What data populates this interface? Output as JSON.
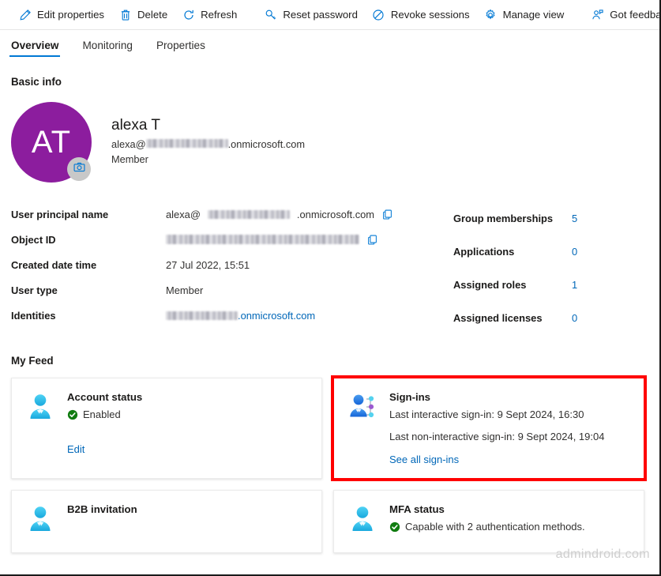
{
  "toolbar": {
    "items": [
      {
        "label": "Edit properties",
        "icon": "pencil-icon"
      },
      {
        "label": "Delete",
        "icon": "trash-icon"
      },
      {
        "label": "Refresh",
        "icon": "refresh-icon"
      },
      {
        "label": "Reset password",
        "icon": "key-icon"
      },
      {
        "label": "Revoke sessions",
        "icon": "block-icon"
      },
      {
        "label": "Manage view",
        "icon": "gear-icon"
      },
      {
        "label": "Got feedback?",
        "icon": "feedback-person-icon"
      }
    ]
  },
  "tabs": [
    {
      "label": "Overview",
      "active": true
    },
    {
      "label": "Monitoring",
      "active": false
    },
    {
      "label": "Properties",
      "active": false
    }
  ],
  "sections": {
    "basic_info": "Basic info",
    "my_feed": "My Feed"
  },
  "identity": {
    "initials": "AT",
    "display_name": "alexa T",
    "upn_prefix": "alexa@",
    "upn_suffix": ".onmicrosoft.com",
    "user_type": "Member",
    "camera_icon": "camera-icon"
  },
  "properties_left": [
    {
      "label": "User principal name",
      "value_prefix": "alexa@",
      "value_suffix": ".onmicrosoft.com",
      "redacted": true,
      "redact_width": 104,
      "copy": true
    },
    {
      "label": "Object ID",
      "value_prefix": "",
      "value_suffix": "",
      "redacted": true,
      "redact_width": 245,
      "copy": true
    },
    {
      "label": "Created date time",
      "value_prefix": "27 Jul 2022, 15:51",
      "value_suffix": "",
      "redacted": false,
      "copy": false
    },
    {
      "label": "User type",
      "value_prefix": "Member",
      "value_suffix": "",
      "redacted": false,
      "copy": false
    },
    {
      "label": "Identities",
      "value_prefix": "",
      "value_suffix": ".onmicrosoft.com",
      "redacted": true,
      "redact_width": 91,
      "copy": false,
      "link": true
    }
  ],
  "properties_right": [
    {
      "label": "Group memberships",
      "value": "5"
    },
    {
      "label": "Applications",
      "value": "0"
    },
    {
      "label": "Assigned roles",
      "value": "1"
    },
    {
      "label": "Assigned licenses",
      "value": "0"
    }
  ],
  "feed_cards": [
    {
      "id": "account-status",
      "title": "Account status",
      "icon": "user-icon",
      "status_text": "Enabled",
      "status_icon": "check-circle-icon",
      "link": "Edit",
      "highlighted": false
    },
    {
      "id": "sign-ins",
      "title": "Sign-ins",
      "icon": "user-network-icon",
      "line1": "Last interactive sign-in: 9 Sept 2024, 16:30",
      "line2": "Last non-interactive sign-in: 9 Sept 2024, 19:04",
      "link": "See all sign-ins",
      "highlighted": true
    },
    {
      "id": "b2b-invitation",
      "title": "B2B invitation",
      "icon": "user-icon",
      "highlighted": false
    },
    {
      "id": "mfa-status",
      "title": "MFA status",
      "icon": "user-icon",
      "status_text": "Capable with 2 authentication methods.",
      "status_icon": "check-circle-icon",
      "highlighted": false
    }
  ],
  "colors": {
    "accent": "#0078d4",
    "link": "#0067b8",
    "avatar": "#8c1d9e",
    "highlight": "#ff0000",
    "success": "#107c10"
  },
  "watermark": "admindroid.com"
}
